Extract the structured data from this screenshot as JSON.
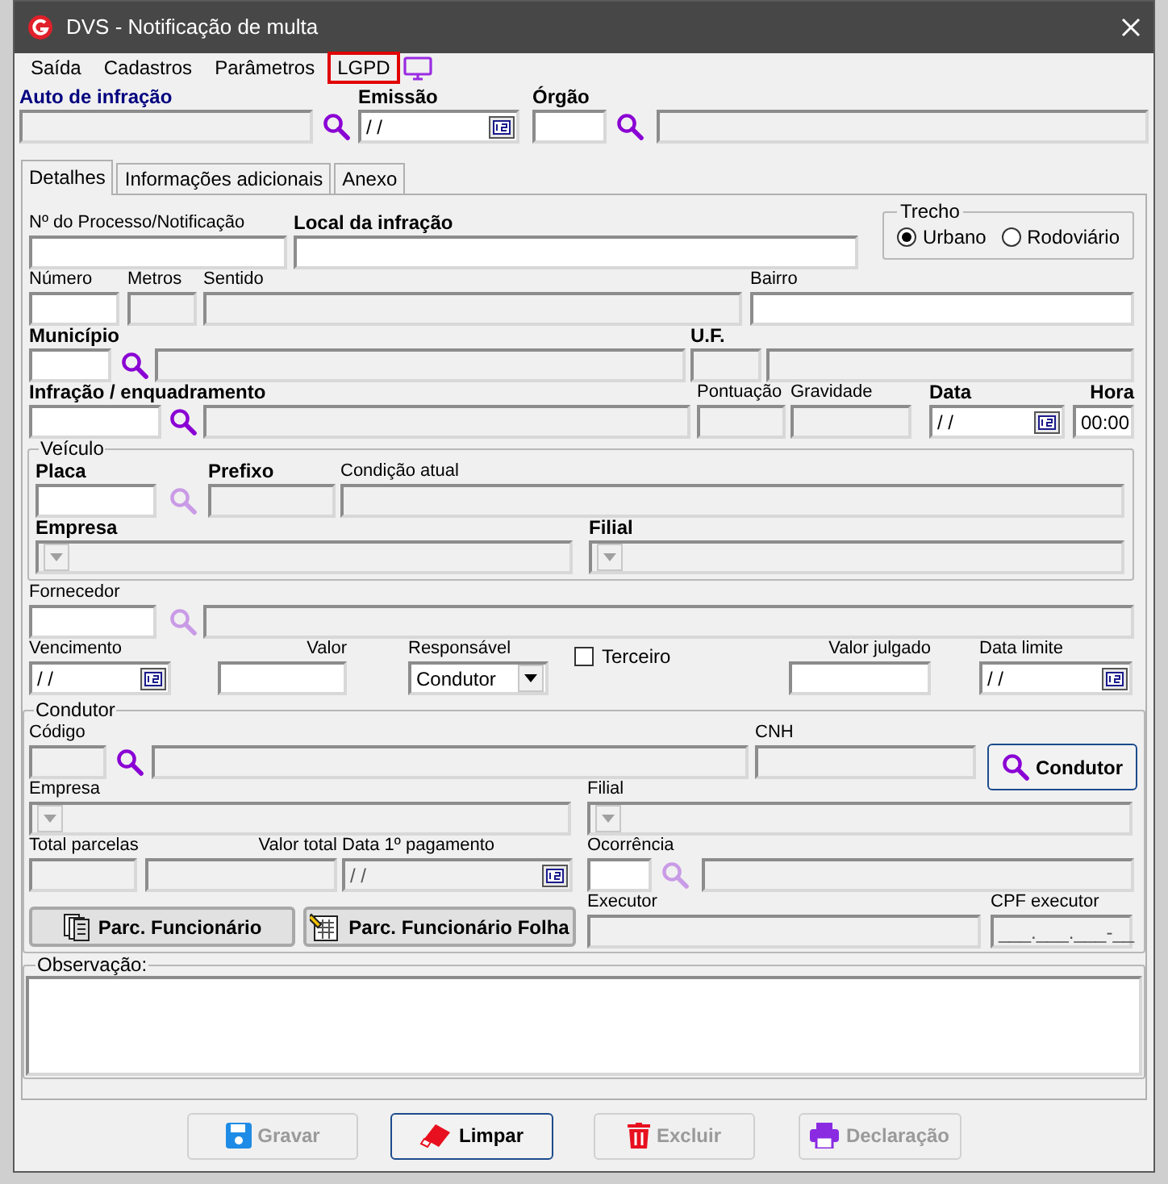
{
  "window": {
    "title": "DVS - Notificação de multa"
  },
  "menu": [
    {
      "label": "Saída",
      "highlighted": false
    },
    {
      "label": "Cadastros",
      "highlighted": false
    },
    {
      "label": "Parâmetros",
      "highlighted": false
    },
    {
      "label": "LGPD",
      "highlighted": true
    }
  ],
  "header": [
    {
      "kind": "field",
      "label": "Auto de infração",
      "required": true,
      "primary": true,
      "disabled": true
    },
    {
      "kind": "search",
      "disabled": false
    },
    {
      "kind": "date",
      "label": "Emissão",
      "required": true,
      "disabled": false,
      "value": "/ /"
    },
    {
      "kind": "field",
      "label": "Órgão",
      "required": true,
      "disabled": false
    },
    {
      "kind": "search",
      "disabled": false
    },
    {
      "kind": "field",
      "disabled": true
    }
  ],
  "tabs": [
    {
      "label": "Detalhes",
      "selected": true
    },
    {
      "label": "Informações adicionais",
      "selected": false
    },
    {
      "label": "Anexo",
      "selected": false
    }
  ],
  "details": {
    "rows": [
      {
        "items": [
          {
            "kind": "field",
            "label": "Nº do Processo/Notificação",
            "required": false,
            "disabled": false
          },
          {
            "kind": "field",
            "label": "Local da infração",
            "required": true,
            "disabled": false
          },
          {
            "kind": "radio-group",
            "label": "Trecho",
            "options": [
              {
                "label": "Urbano",
                "selected": true
              },
              {
                "label": "Rodoviário",
                "selected": false
              }
            ]
          }
        ]
      },
      {
        "items": [
          {
            "kind": "field",
            "label": "Número",
            "required": false,
            "disabled": false
          },
          {
            "kind": "field",
            "label": "Metros",
            "required": false,
            "disabled": true
          },
          {
            "kind": "field",
            "label": "Sentido",
            "required": false,
            "disabled": true
          },
          {
            "kind": "field",
            "label": "Bairro",
            "required": false,
            "disabled": false
          }
        ]
      },
      {
        "items": [
          {
            "kind": "field",
            "label": "Município",
            "required": true,
            "disabled": false
          },
          {
            "kind": "search",
            "disabled": false
          },
          {
            "kind": "field",
            "disabled": true
          },
          {
            "kind": "field",
            "label": "U.F.",
            "required": true,
            "disabled": true
          },
          {
            "kind": "field",
            "disabled": true
          }
        ]
      },
      {
        "items": [
          {
            "kind": "field",
            "label": "Infração / enquadramento",
            "required": true,
            "disabled": false
          },
          {
            "kind": "search",
            "disabled": false
          },
          {
            "kind": "field",
            "disabled": true
          },
          {
            "kind": "field",
            "label": "Pontuação",
            "required": false,
            "disabled": true
          },
          {
            "kind": "field",
            "label": "Gravidade",
            "required": false,
            "disabled": true
          },
          {
            "kind": "date",
            "label": "Data",
            "required": true,
            "disabled": false,
            "value": "/ /"
          },
          {
            "kind": "field",
            "label": "Hora",
            "required": true,
            "disabled": false,
            "value": "00:00"
          }
        ]
      }
    ],
    "vehicle": {
      "title": "Veículo",
      "rows": [
        {
          "items": [
            {
              "kind": "field",
              "label": "Placa",
              "required": true,
              "disabled": false
            },
            {
              "kind": "search",
              "disabled": true
            },
            {
              "kind": "field",
              "label": "Prefixo",
              "required": true,
              "disabled": true
            },
            {
              "kind": "field",
              "label": "Condição atual",
              "required": false,
              "disabled": true
            }
          ]
        },
        {
          "items": [
            {
              "kind": "select",
              "label": "Empresa",
              "required": true,
              "disabled": true
            },
            {
              "kind": "select",
              "label": "Filial",
              "required": true,
              "disabled": true
            }
          ]
        }
      ]
    },
    "rows2": [
      {
        "items": [
          {
            "kind": "field",
            "label": "Fornecedor",
            "required": false,
            "disabled": false
          },
          {
            "kind": "search",
            "disabled": true
          },
          {
            "kind": "field",
            "disabled": true
          }
        ]
      },
      {
        "items": [
          {
            "kind": "date",
            "label": "Vencimento",
            "required": false,
            "disabled": false,
            "value": "/ /"
          },
          {
            "kind": "field",
            "label": "Valor",
            "required": false,
            "disabled": false
          },
          {
            "kind": "select",
            "label": "Responsável",
            "required": false,
            "disabled": false,
            "value": "Condutor"
          },
          {
            "kind": "checkbox",
            "label": "Terceiro",
            "checked": false
          },
          {
            "kind": "field",
            "label": "Valor julgado",
            "required": false,
            "disabled": false
          },
          {
            "kind": "date",
            "label": "Data limite",
            "required": false,
            "disabled": false,
            "value": "/ /"
          }
        ]
      }
    ],
    "driver": {
      "title": "Condutor",
      "rows": [
        {
          "items": [
            {
              "kind": "field",
              "label": "Código",
              "required": false,
              "disabled": true
            },
            {
              "kind": "search",
              "disabled": false
            },
            {
              "kind": "field",
              "disabled": true
            },
            {
              "kind": "field",
              "label": "CNH",
              "required": false,
              "disabled": true
            },
            {
              "kind": "button",
              "label": "Condutor",
              "disabled": false,
              "default": true
            }
          ]
        },
        {
          "items": [
            {
              "kind": "select",
              "label": "Empresa",
              "required": false,
              "disabled": true
            },
            {
              "kind": "select",
              "label": "Filial",
              "required": false,
              "disabled": true
            }
          ]
        },
        {
          "items": [
            {
              "kind": "field",
              "label": "Total parcelas",
              "required": false,
              "disabled": true
            },
            {
              "kind": "field",
              "label": "Valor total",
              "required": false,
              "disabled": true
            },
            {
              "kind": "date",
              "label": "Data 1º pagamento",
              "required": false,
              "disabled": true,
              "value": "/ /"
            },
            {
              "kind": "field",
              "label": "Ocorrência",
              "required": false,
              "disabled": false
            },
            {
              "kind": "search",
              "disabled": true
            },
            {
              "kind": "field",
              "disabled": true
            }
          ]
        },
        {
          "items": [
            {
              "kind": "button",
              "label": "Parc. Funcionário",
              "disabled": false,
              "default": false
            },
            {
              "kind": "button",
              "label": "Parc. Funcionário Folha",
              "disabled": false,
              "default": false
            },
            {
              "kind": "field",
              "label": "Executor",
              "required": false,
              "disabled": true
            },
            {
              "kind": "field",
              "label": "CPF executor",
              "required": false,
              "disabled": true,
              "value": "___.___.___-__"
            }
          ]
        }
      ]
    },
    "notes": {
      "title": "Observação:"
    }
  },
  "buttons": [
    {
      "label": "Gravar",
      "disabled": true,
      "default": false
    },
    {
      "label": "Limpar",
      "disabled": false,
      "default": true
    },
    {
      "label": "Excluir",
      "disabled": true,
      "default": false
    },
    {
      "label": "Declaração",
      "disabled": true,
      "default": false
    }
  ]
}
